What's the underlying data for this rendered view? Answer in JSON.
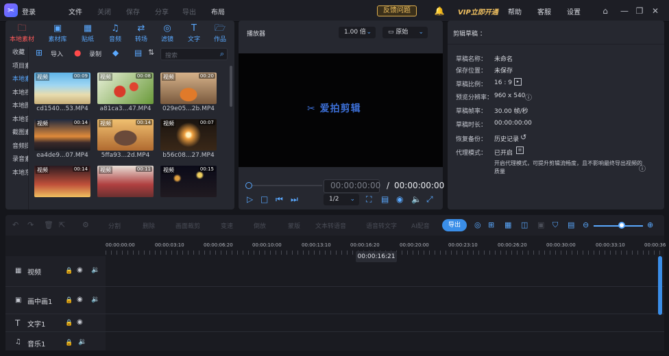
{
  "titlebar": {
    "login": "登录",
    "menu": [
      "文件",
      "关闭",
      "保存",
      "分享",
      "导出",
      "布局"
    ],
    "feedback": "反馈问题",
    "vip": "VIP立即开通",
    "help": "帮助",
    "service": "客服",
    "settings": "设置"
  },
  "media": {
    "tabs": [
      "本地素材",
      "素材库",
      "贴纸",
      "音频",
      "转场",
      "滤镜",
      "文字",
      "作品"
    ],
    "sidebar": [
      "收藏",
      "项目素材",
      "本地素材",
      "本地视频",
      "本地图片",
      "本地音频",
      "截图素材",
      "音频提取",
      "录音素材",
      "本地东西"
    ],
    "import": "导入",
    "record": "录制",
    "search_placeholder": "搜索",
    "tag": "视频",
    "items": [
      {
        "name": "cd1540...53.MP4",
        "dur": "00:09"
      },
      {
        "name": "a81ca3...47.MP4",
        "dur": "00:08"
      },
      {
        "name": "029e05...2b.MP4",
        "dur": "00:20"
      },
      {
        "name": "ea4de9...07.MP4",
        "dur": "00:14"
      },
      {
        "name": "5ffa93...2d.MP4",
        "dur": "00:14"
      },
      {
        "name": "b56c08...27.MP4",
        "dur": "00:07"
      },
      {
        "name": "",
        "dur": "00:14"
      },
      {
        "name": "",
        "dur": "00:11"
      },
      {
        "name": "",
        "dur": "00:15"
      }
    ]
  },
  "player": {
    "title": "播放器",
    "speed": "1.00 倍",
    "ratio": "原始",
    "watermark": "爱拍剪辑",
    "current": "00:00:00:00",
    "sep": "/",
    "total": "00:00:00:00",
    "page": "1/2"
  },
  "draft": {
    "title": "剪辑草稿 ：",
    "rows": [
      {
        "k": "草稿名称：",
        "v": "未命名"
      },
      {
        "k": "保存位置：",
        "v": "未保存"
      },
      {
        "k": "草稿比例：",
        "v": "16 : 9"
      },
      {
        "k": "预览分辨率：",
        "v": "960 x 540"
      },
      {
        "k": "草稿帧率：",
        "v": "30.00 帧/秒"
      },
      {
        "k": "草稿时长：",
        "v": "00:00:00:00"
      },
      {
        "k": "恢复备份：",
        "v": "历史记录"
      },
      {
        "k": "代理模式：",
        "v": "已开启"
      }
    ],
    "proxy_note": "开启代理模式，可提升剪辑流畅度，且不影响最终导出视频的质量"
  },
  "timeline": {
    "tools": [
      "分割",
      "删除",
      "画面裁剪",
      "变速",
      "倒放",
      "蒙版",
      "文本转语音",
      "语音转文字",
      "AI配音"
    ],
    "export": "导出",
    "ticks": [
      "00:00:00:00",
      "00:00:03:10",
      "00:00:06:20",
      "00:00:10:00",
      "00:00:13:10",
      "00:00:16:20",
      "00:00:20:00",
      "00:00:23:10",
      "00:00:26:20",
      "00:00:30:00",
      "00:00:33:10",
      "00:00:36"
    ],
    "cursor": "00:00:16:21",
    "tracks": [
      "视频",
      "画中画1",
      "文字1",
      "音乐1"
    ]
  }
}
